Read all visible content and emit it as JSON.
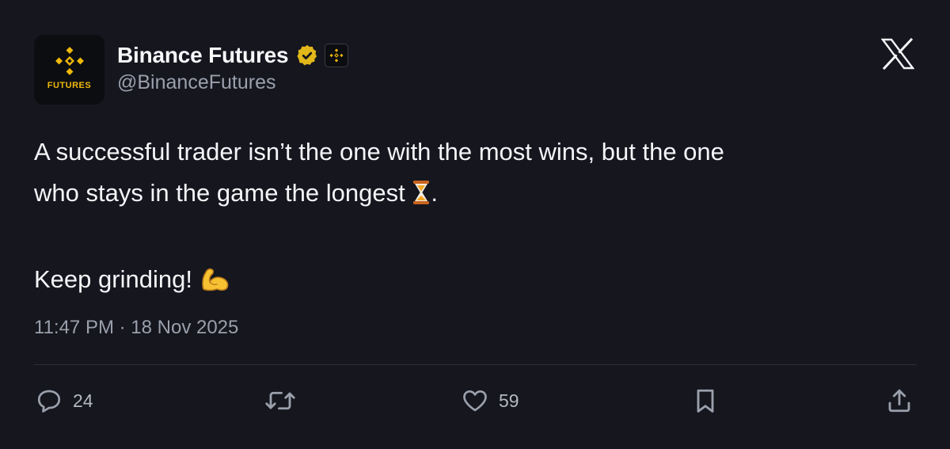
{
  "header": {
    "display_name": "Binance Futures",
    "handle": "@BinanceFutures",
    "avatar_label": "FUTURES",
    "verified_icon": "verified-badge-icon",
    "affiliate_icon": "binance-logo-icon",
    "platform_icon": "x-logo-icon"
  },
  "tweet": {
    "line1": "A successful trader isn’t the one with the most wins, but the one",
    "line2_text": "who stays in the game the longest ",
    "line2_end": ".",
    "line3_text": "Keep grinding! ",
    "emoji_1": "hourglass-emoji",
    "emoji_2": "flexed-biceps-emoji",
    "timestamp": "11:47 PM · 18 Nov 2025"
  },
  "actions": {
    "reply_count": "24",
    "like_count": "59"
  },
  "colors": {
    "background": "#15161e",
    "brand": "#f0b90b",
    "verified": "#e2b719",
    "muted_text": "#9aa0ac"
  }
}
